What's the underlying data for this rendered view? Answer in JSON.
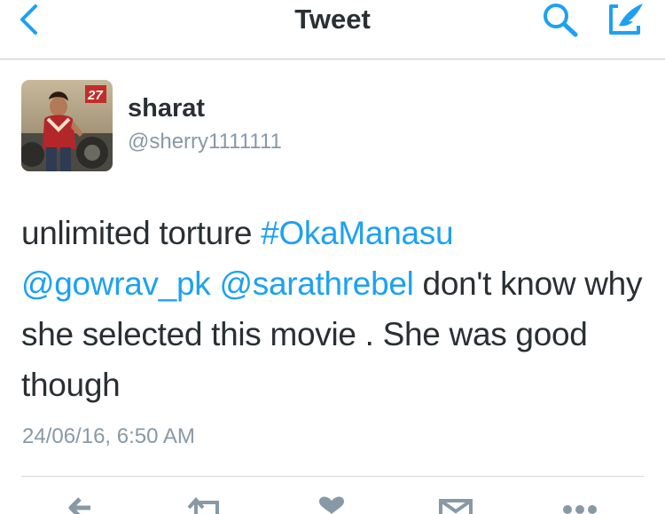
{
  "nav": {
    "title": "Tweet",
    "icons": [
      "back-chevron-icon",
      "search-icon",
      "compose-icon"
    ]
  },
  "author": {
    "name": "sharat",
    "handle": "@sherry1111111",
    "avatar_badge": "27"
  },
  "tweet": {
    "segments": [
      {
        "text": "unlimited torture ",
        "link": false
      },
      {
        "text": "#OkaManasu",
        "link": true
      },
      {
        "text": "@gowrav_pk",
        "link": true
      },
      {
        "text": " ",
        "link": false
      },
      {
        "text": "@sarathrebel",
        "link": true
      },
      {
        "text": "  don't know why she selected this movie . She was good though",
        "link": false
      }
    ],
    "timestamp": "24/06/16, 6:50 AM"
  },
  "actions": [
    "reply-icon",
    "retweet-icon",
    "like-icon",
    "dm-icon",
    "more-icon"
  ],
  "colors": {
    "accent": "#1da1f2",
    "text": "#292f33",
    "muted": "#8899a6",
    "divider": "#d8d8d8"
  }
}
